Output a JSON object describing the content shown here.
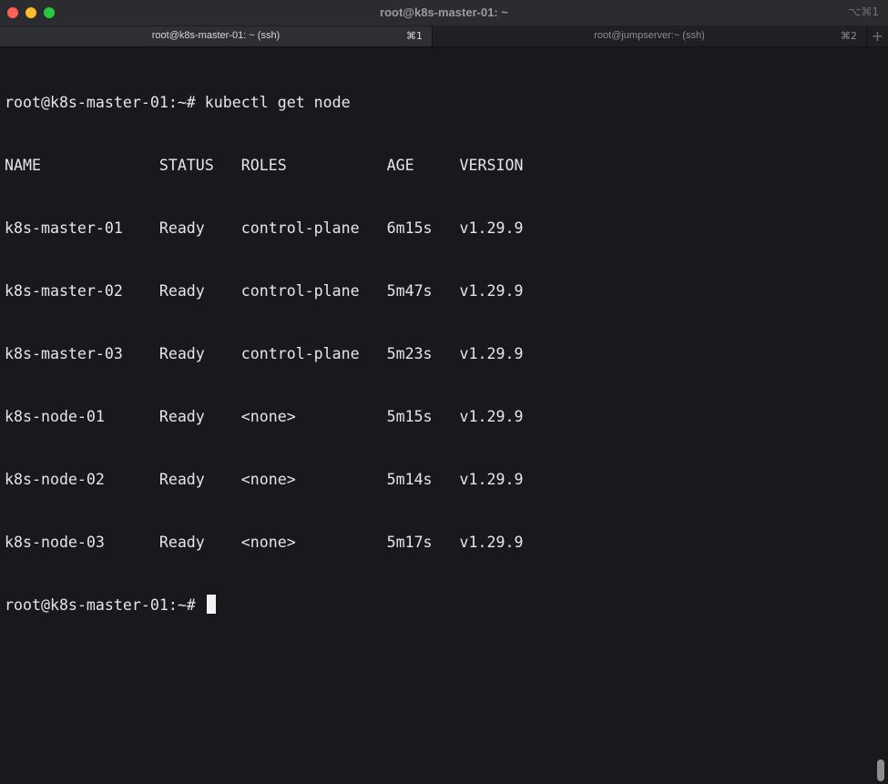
{
  "window": {
    "title": "root@k8s-master-01: ~",
    "shortcut": "⌥⌘1"
  },
  "tabs": [
    {
      "label": "root@k8s-master-01: ~ (ssh)",
      "shortcut": "⌘1"
    },
    {
      "label": "root@jumpserver:~ (ssh)",
      "shortcut": "⌘2"
    }
  ],
  "new_tab_label": "+",
  "terminal": {
    "lines": [
      "root@k8s-master-01:~# kubectl get node",
      "NAME             STATUS   ROLES           AGE     VERSION",
      "k8s-master-01    Ready    control-plane   6m15s   v1.29.9",
      "k8s-master-02    Ready    control-plane   5m47s   v1.29.9",
      "k8s-master-03    Ready    control-plane   5m23s   v1.29.9",
      "k8s-node-01      Ready    <none>          5m15s   v1.29.9",
      "k8s-node-02      Ready    <none>          5m14s   v1.29.9",
      "k8s-node-03      Ready    <none>          5m17s   v1.29.9"
    ],
    "prompt": "root@k8s-master-01:~# "
  },
  "colors": {
    "background": "#18191d",
    "text": "#e6e6e8",
    "close": "#ff5f57",
    "minimize": "#febc2e",
    "maximize": "#28c840"
  }
}
